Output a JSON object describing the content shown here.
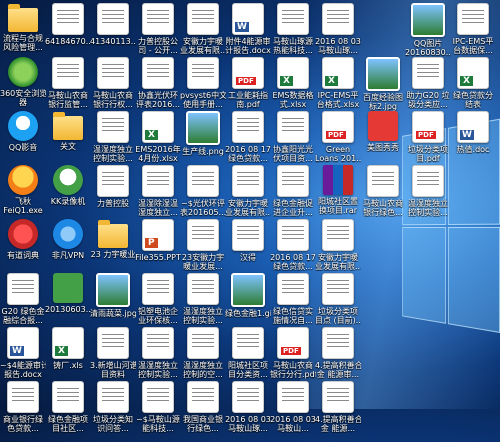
{
  "desktop": {
    "icons": [
      {
        "name": "icon-1",
        "label1": "流程与合规",
        "label2": "风险管理...",
        "kind": "folder"
      },
      {
        "name": "icon-2",
        "label1": "64184670...",
        "label2": "",
        "kind": "doc"
      },
      {
        "name": "icon-3",
        "label1": "41340113...",
        "label2": "",
        "kind": "doc"
      },
      {
        "name": "icon-4",
        "label1": "力普控股公",
        "label2": "司 - 公开...",
        "kind": "doc"
      },
      {
        "name": "icon-5",
        "label1": "安徽力宇暖",
        "label2": "业发展有限...",
        "kind": "doc"
      },
      {
        "name": "icon-6",
        "label1": "附件4能源审",
        "label2": "计报告.docx",
        "kind": "word"
      },
      {
        "name": "icon-7",
        "label1": "马鞍山琢源",
        "label2": "热能科技...",
        "kind": "doc"
      },
      {
        "name": "icon-8",
        "label1": "2016 08 03",
        "label2": "马鞍山琢...",
        "kind": "doc"
      },
      {
        "name": "icon-9",
        "label1": "",
        "label2": "",
        "kind": "none"
      },
      {
        "name": "icon-10",
        "label1": "QQ图片",
        "label2": "20160830...",
        "kind": "img"
      },
      {
        "name": "icon-11",
        "label1": "IPC-EMS平",
        "label2": "台数据保...",
        "kind": "doc"
      },
      {
        "name": "icon-12",
        "label1": "360安全浏览",
        "label2": "器",
        "kind": "app360"
      },
      {
        "name": "icon-13",
        "label1": "马鞍山农商",
        "label2": "银行监管...",
        "kind": "doc"
      },
      {
        "name": "icon-14",
        "label1": "马鞍山农商",
        "label2": "银行行权...",
        "kind": "doc"
      },
      {
        "name": "icon-15",
        "label1": "协鑫光伏环",
        "label2": "评表2016...",
        "kind": "doc"
      },
      {
        "name": "icon-16",
        "label1": "pvsyst6中文",
        "label2": "使用手册...",
        "kind": "doc"
      },
      {
        "name": "icon-17",
        "label1": "工业能耗指",
        "label2": "南.pdf",
        "kind": "pdf"
      },
      {
        "name": "icon-18",
        "label1": "EMS数据格",
        "label2": "式.xlsx",
        "kind": "xls"
      },
      {
        "name": "icon-19",
        "label1": "IPC-EMS平",
        "label2": "台格式.xlsx",
        "kind": "xls"
      },
      {
        "name": "icon-20",
        "label1": "百度经验图",
        "label2": "标2.jpg",
        "kind": "img"
      },
      {
        "name": "icon-21",
        "label1": "助力G20 垃",
        "label2": "圾分类应...",
        "kind": "doc"
      },
      {
        "name": "icon-22",
        "label1": "绿色贷款分",
        "label2": "结表",
        "kind": "xls"
      },
      {
        "name": "icon-23",
        "label1": "QQ影音",
        "label2": "",
        "kind": "qq"
      },
      {
        "name": "icon-24",
        "label1": "关文",
        "label2": "",
        "kind": "folder"
      },
      {
        "name": "icon-25",
        "label1": "温湿度独立",
        "label2": "控制实验...",
        "kind": "doc"
      },
      {
        "name": "icon-26",
        "label1": "EMS2016年",
        "label2": "4月份.xlsx",
        "kind": "xls"
      },
      {
        "name": "icon-27",
        "label1": "生产线.png",
        "label2": "",
        "kind": "img"
      },
      {
        "name": "icon-28",
        "label1": "2016 08 17",
        "label2": "绿色贷款...",
        "kind": "doc"
      },
      {
        "name": "icon-29",
        "label1": "协鑫阳光光",
        "label2": "伏项目资...",
        "kind": "doc"
      },
      {
        "name": "icon-30",
        "label1": "Green",
        "label2": "Loans 201...",
        "kind": "pdf"
      },
      {
        "name": "icon-31",
        "label1": "美图秀秀",
        "label2": "",
        "kind": "red"
      },
      {
        "name": "icon-32",
        "label1": "垃圾分类项",
        "label2": "目.pdf",
        "kind": "pdf"
      },
      {
        "name": "icon-33",
        "label1": "热值.doc",
        "label2": "",
        "kind": "word"
      },
      {
        "name": "icon-34",
        "label1": "飞秋",
        "label2": "FeiQ1.exe",
        "kind": "feiq"
      },
      {
        "name": "icon-35",
        "label1": "KK录像机",
        "label2": "",
        "kind": "kk"
      },
      {
        "name": "icon-36",
        "label1": "力普控股",
        "label2": "",
        "kind": "doc"
      },
      {
        "name": "icon-37",
        "label1": "温湿除湿温",
        "label2": "湿度独立...",
        "kind": "doc"
      },
      {
        "name": "icon-38",
        "label1": "~$光伏环评",
        "label2": "表201605...",
        "kind": "doc"
      },
      {
        "name": "icon-39",
        "label1": "安徽力宇暖",
        "label2": "业发展有限...",
        "kind": "doc"
      },
      {
        "name": "icon-40",
        "label1": "绿色金融促",
        "label2": "进企业升...",
        "kind": "doc"
      },
      {
        "name": "icon-41",
        "label1": "阳城社区置",
        "label2": "换项目.rar",
        "kind": "rar"
      },
      {
        "name": "icon-42",
        "label1": "马鞍山农商",
        "label2": "银行绿色...",
        "kind": "doc"
      },
      {
        "name": "icon-43",
        "label1": "温湿度独立",
        "label2": "控制实验...",
        "kind": "doc"
      },
      {
        "name": "icon-44",
        "label1": "",
        "label2": "",
        "kind": "none"
      },
      {
        "name": "icon-45",
        "label1": "有道词典",
        "label2": "",
        "kind": "youdao"
      },
      {
        "name": "icon-46",
        "label1": "非凡VPN",
        "label2": "",
        "kind": "vpn"
      },
      {
        "name": "icon-47",
        "label1": "23 力宇暖业",
        "label2": "",
        "kind": "folder"
      },
      {
        "name": "icon-48",
        "label1": "File355.PPT",
        "label2": "",
        "kind": "ppt"
      },
      {
        "name": "icon-49",
        "label1": "23安徽力宇",
        "label2": "暖业发展...",
        "kind": "doc"
      },
      {
        "name": "icon-50",
        "label1": "汉得",
        "label2": "",
        "kind": "doc"
      },
      {
        "name": "icon-51",
        "label1": "2016 08 17",
        "label2": "绿色贷款...",
        "kind": "doc"
      },
      {
        "name": "icon-52",
        "label1": "安徽力宇暖",
        "label2": "业发展有限...",
        "kind": "doc"
      },
      {
        "name": "icon-53",
        "label1": "",
        "label2": "",
        "kind": "none"
      },
      {
        "name": "icon-54",
        "label1": "",
        "label2": "",
        "kind": "none"
      },
      {
        "name": "icon-55",
        "label1": "",
        "label2": "",
        "kind": "none"
      },
      {
        "name": "icon-56",
        "label1": "G20 绿色金",
        "label2": "融综合报...",
        "kind": "doc"
      },
      {
        "name": "icon-57",
        "label1": "20130603...",
        "label2": "",
        "kind": "green"
      },
      {
        "name": "icon-58",
        "label1": "清雨蔬菜.jpg",
        "label2": "",
        "kind": "img"
      },
      {
        "name": "icon-59",
        "label1": "铝塑电池企",
        "label2": "业环保核...",
        "kind": "doc"
      },
      {
        "name": "icon-60",
        "label1": "温湿度独立",
        "label2": "控制实验...",
        "kind": "doc"
      },
      {
        "name": "icon-61",
        "label1": "绿色金融1.gif",
        "label2": "",
        "kind": "img"
      },
      {
        "name": "icon-62",
        "label1": "绿色信贷实",
        "label2": "施情况自...",
        "kind": "doc"
      },
      {
        "name": "icon-63",
        "label1": "垃圾分类项",
        "label2": "目点 (目前)...",
        "kind": "doc"
      },
      {
        "name": "icon-64",
        "label1": "",
        "label2": "",
        "kind": "none"
      },
      {
        "name": "icon-65",
        "label1": "",
        "label2": "",
        "kind": "none"
      },
      {
        "name": "icon-66",
        "label1": "",
        "label2": "",
        "kind": "none"
      },
      {
        "name": "icon-67",
        "label1": "~$4能源审计",
        "label2": "报告.docx",
        "kind": "word"
      },
      {
        "name": "icon-68",
        "label1": "铸厂.xls",
        "label2": "",
        "kind": "xls"
      },
      {
        "name": "icon-69",
        "label1": "3.新增山河谱",
        "label2": "目资料",
        "kind": "doc"
      },
      {
        "name": "icon-70",
        "label1": "温湿度独立",
        "label2": "控制实验...",
        "kind": "doc"
      },
      {
        "name": "icon-71",
        "label1": "温湿度独立",
        "label2": "控制的空...",
        "kind": "doc"
      },
      {
        "name": "icon-72",
        "label1": "阳城社区项",
        "label2": "目分类资...",
        "kind": "doc"
      },
      {
        "name": "icon-73",
        "label1": "马鞍山农商",
        "label2": "银行分行.pdf",
        "kind": "pdf"
      },
      {
        "name": "icon-74",
        "label1": "4.提高积善合",
        "label2": "金 能源审...",
        "kind": "doc"
      },
      {
        "name": "icon-75",
        "label1": "",
        "label2": "",
        "kind": "none"
      },
      {
        "name": "icon-76",
        "label1": "",
        "label2": "",
        "kind": "none"
      },
      {
        "name": "icon-77",
        "label1": "",
        "label2": "",
        "kind": "none"
      },
      {
        "name": "icon-78",
        "label1": "商业银行绿",
        "label2": "色贷款...",
        "kind": "doc"
      },
      {
        "name": "icon-79",
        "label1": "绿色金融项",
        "label2": "目社区...",
        "kind": "doc"
      },
      {
        "name": "icon-80",
        "label1": "垃圾分类知",
        "label2": "识问答...",
        "kind": "doc"
      },
      {
        "name": "icon-81",
        "label1": "~$马鞍山源",
        "label2": "能科技...",
        "kind": "doc"
      },
      {
        "name": "icon-82",
        "label1": "我国商业银",
        "label2": "行绿色...",
        "kind": "doc"
      },
      {
        "name": "icon-83",
        "label1": "2016 08 03",
        "label2": "马鞍山琢...",
        "kind": "doc"
      },
      {
        "name": "icon-84",
        "label1": "2016 08 03",
        "label2": "马鞍山...",
        "kind": "doc"
      },
      {
        "name": "icon-85",
        "label1": "4.提高积善合",
        "label2": "金 能源...",
        "kind": "doc"
      },
      {
        "name": "icon-86",
        "label1": "",
        "label2": "",
        "kind": "none"
      },
      {
        "name": "icon-87",
        "label1": "",
        "label2": "",
        "kind": "none"
      },
      {
        "name": "icon-88",
        "label1": "",
        "label2": "",
        "kind": "none"
      }
    ]
  }
}
